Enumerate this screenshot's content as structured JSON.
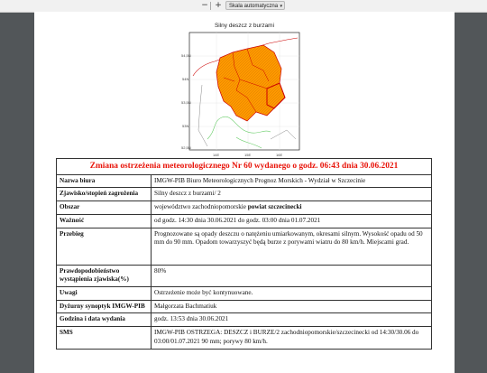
{
  "toolbar": {
    "zoom_out": "−",
    "zoom_in": "+",
    "zoom_value": "Skala automatyczna",
    "dropdown_arrow": "▾"
  },
  "map": {
    "title": "Silny deszcz z burzami",
    "colors": {
      "warning_fill": "#ff9900",
      "county_border": "#cc0000",
      "gray_border": "#888888",
      "river": "#66cc66"
    },
    "lat_labels": [
      "54,5N",
      "54N",
      "53,5N",
      "53N",
      "52,5N"
    ],
    "lon_labels": [
      "14E",
      "15E",
      "16E"
    ]
  },
  "warning": {
    "title": "Zmiana ostrzeżenia meteorologicznego Nr 60 wydanego o godz. 06:43 dnia 30.06.2021",
    "rows": [
      {
        "label": "Nazwa biura",
        "value": "IMGW-PIB Biuro Meteorologicznych Prognoz Morskich - Wydział w Szczecinie"
      },
      {
        "label": "Zjawisko/stopień zagrożenia",
        "value": "Silny deszcz z burzami/ 2"
      },
      {
        "label": "Obszar",
        "value_prefix": "województwo zachodniopomorskie ",
        "value_bold": "powiat szczecinecki"
      },
      {
        "label": "Ważność",
        "value": "od godz. 14:30 dnia 30.06.2021 do godz. 03:00 dnia 01.07.2021"
      },
      {
        "label": "Przebieg",
        "value": "Prognozowane są opady deszczu o natężeniu umiarkowanym, okresami silnym. Wysokość opadu od 50 mm do 90 mm. Opadom towarzyszyć będą burze z porywami wiatru do 80 km/h. Miejscami grad."
      },
      {
        "label": "Prawdopodobieństwo wystąpienia zjawiska(%)",
        "value": "80%"
      },
      {
        "label": "Uwagi",
        "value": "Ostrzeżenie może być kontynuowane."
      },
      {
        "label": "Dyżurny synoptyk IMGW-PIB",
        "value": "Małgorzata Bachmatiuk"
      },
      {
        "label": "Godzina i data wydania",
        "value": "godz. 13:53 dnia 30.06.2021"
      },
      {
        "label": "SMS",
        "value": "IMGW-PIB OSTRZEGA: DESZCZ i BURZE/2 zachodniopomorskie/szczecinecki od 14:30/30.06 do 03:00/01.07.2021 90 mm; porywy 80 km/h."
      }
    ]
  }
}
